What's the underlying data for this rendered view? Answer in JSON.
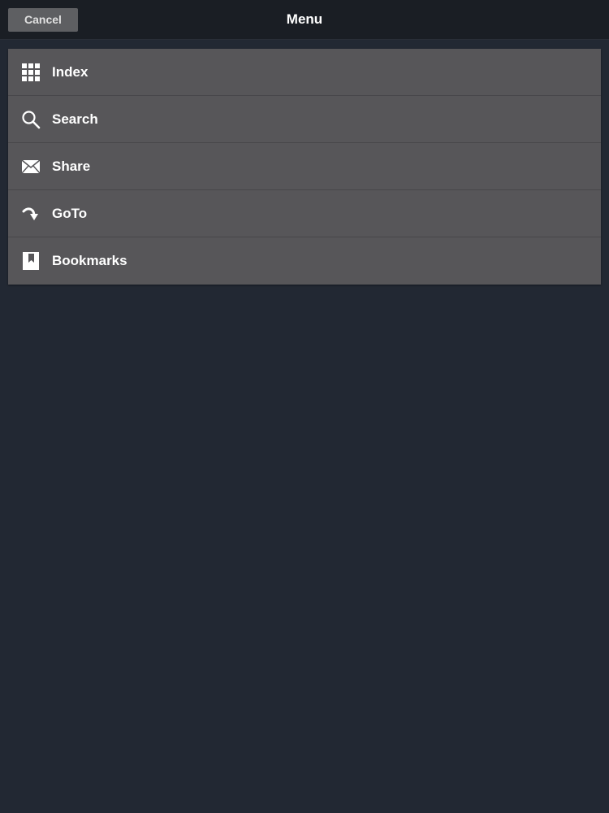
{
  "navbar": {
    "title": "Menu",
    "cancel_label": "Cancel"
  },
  "menu": {
    "items": [
      {
        "label": "Index",
        "icon": "grid-icon"
      },
      {
        "label": "Search",
        "icon": "search-icon"
      },
      {
        "label": "Share",
        "icon": "envelope-icon"
      },
      {
        "label": "GoTo",
        "icon": "goto-arrow-icon"
      },
      {
        "label": "Bookmarks",
        "icon": "bookmark-icon"
      }
    ]
  },
  "colors": {
    "background": "#222833",
    "navbar": "#1a1e24",
    "menu_item": "#575659",
    "text": "#ffffff"
  }
}
